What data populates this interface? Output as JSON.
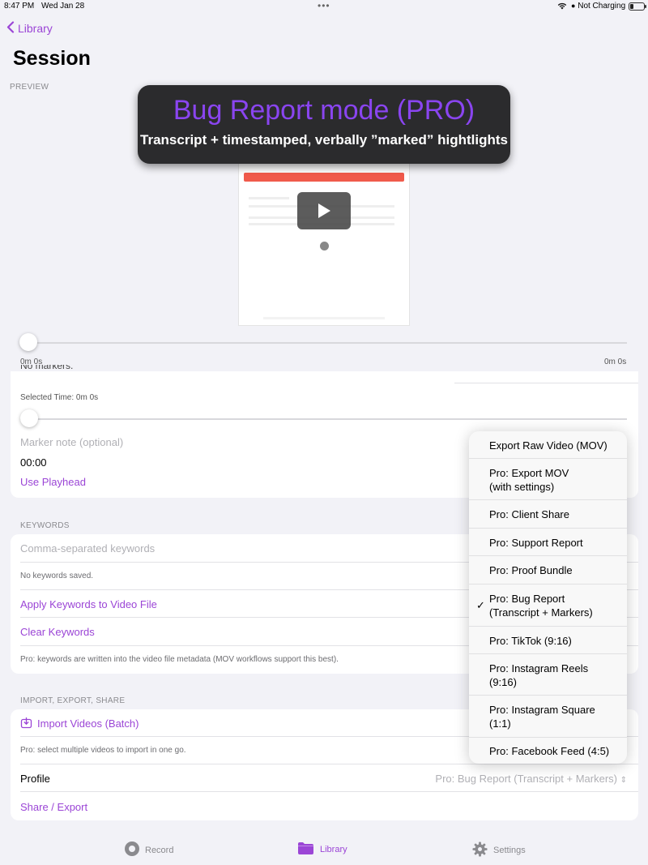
{
  "status": {
    "time": "8:47 PM",
    "date": "Wed Jan 28",
    "battery_text": "Not Charging"
  },
  "nav": {
    "back_label": "Library",
    "title": "Session"
  },
  "preview": {
    "label": "PREVIEW",
    "banner_title": "Bug Report mode (PRO)",
    "banner_subtitle": "Transcript + timestamped, verbally ”marked” hightlights",
    "time_start": "0m 0s",
    "time_end": "0m 0s"
  },
  "markers": {
    "cut_text": "No markers.",
    "selected_time": "Selected Time: 0m 0s",
    "note_placeholder": "Marker note (optional)",
    "time_value": "00:00",
    "use_playhead": "Use Playhead"
  },
  "keywords": {
    "header": "KEYWORDS",
    "placeholder": "Comma-separated keywords",
    "none_saved": "No keywords saved.",
    "apply": "Apply Keywords to Video File",
    "clear": "Clear Keywords",
    "note": "Pro: keywords are written into the video file metadata (MOV workflows support this best)."
  },
  "ies": {
    "header": "IMPORT, EXPORT, SHARE",
    "import": "Import Videos (Batch)",
    "import_note": "Pro: select multiple videos to import in one go.",
    "profile_label": "Profile",
    "profile_value": "Pro: Bug Report (Transcript + Markers)",
    "share": "Share / Export"
  },
  "menu": {
    "items": [
      {
        "l1": "Export Raw Video (MOV)",
        "l2": "",
        "checked": false
      },
      {
        "l1": "Pro: Export MOV",
        "l2": "(with settings)",
        "checked": false
      },
      {
        "l1": "Pro: Client Share",
        "l2": "",
        "checked": false
      },
      {
        "l1": "Pro: Support Report",
        "l2": "",
        "checked": false
      },
      {
        "l1": "Pro: Proof Bundle",
        "l2": "",
        "checked": false
      },
      {
        "l1": "Pro: Bug Report",
        "l2": "(Transcript + Markers)",
        "checked": true
      },
      {
        "l1": "Pro: TikTok (9:16)",
        "l2": "",
        "checked": false
      },
      {
        "l1": "Pro: Instagram Reels",
        "l2": "(9:16)",
        "checked": false
      },
      {
        "l1": "Pro: Instagram Square",
        "l2": "(1:1)",
        "checked": false
      },
      {
        "l1": "Pro: Facebook Feed (4:5)",
        "l2": "",
        "checked": false
      }
    ],
    "check_glyph": "✓"
  },
  "tabbar": {
    "record": "Record",
    "library": "Library",
    "settings": "Settings"
  },
  "colors": {
    "accent": "#9b45d6",
    "banner_title": "#8a45f0",
    "banner_bg": "#2b2b2d"
  }
}
